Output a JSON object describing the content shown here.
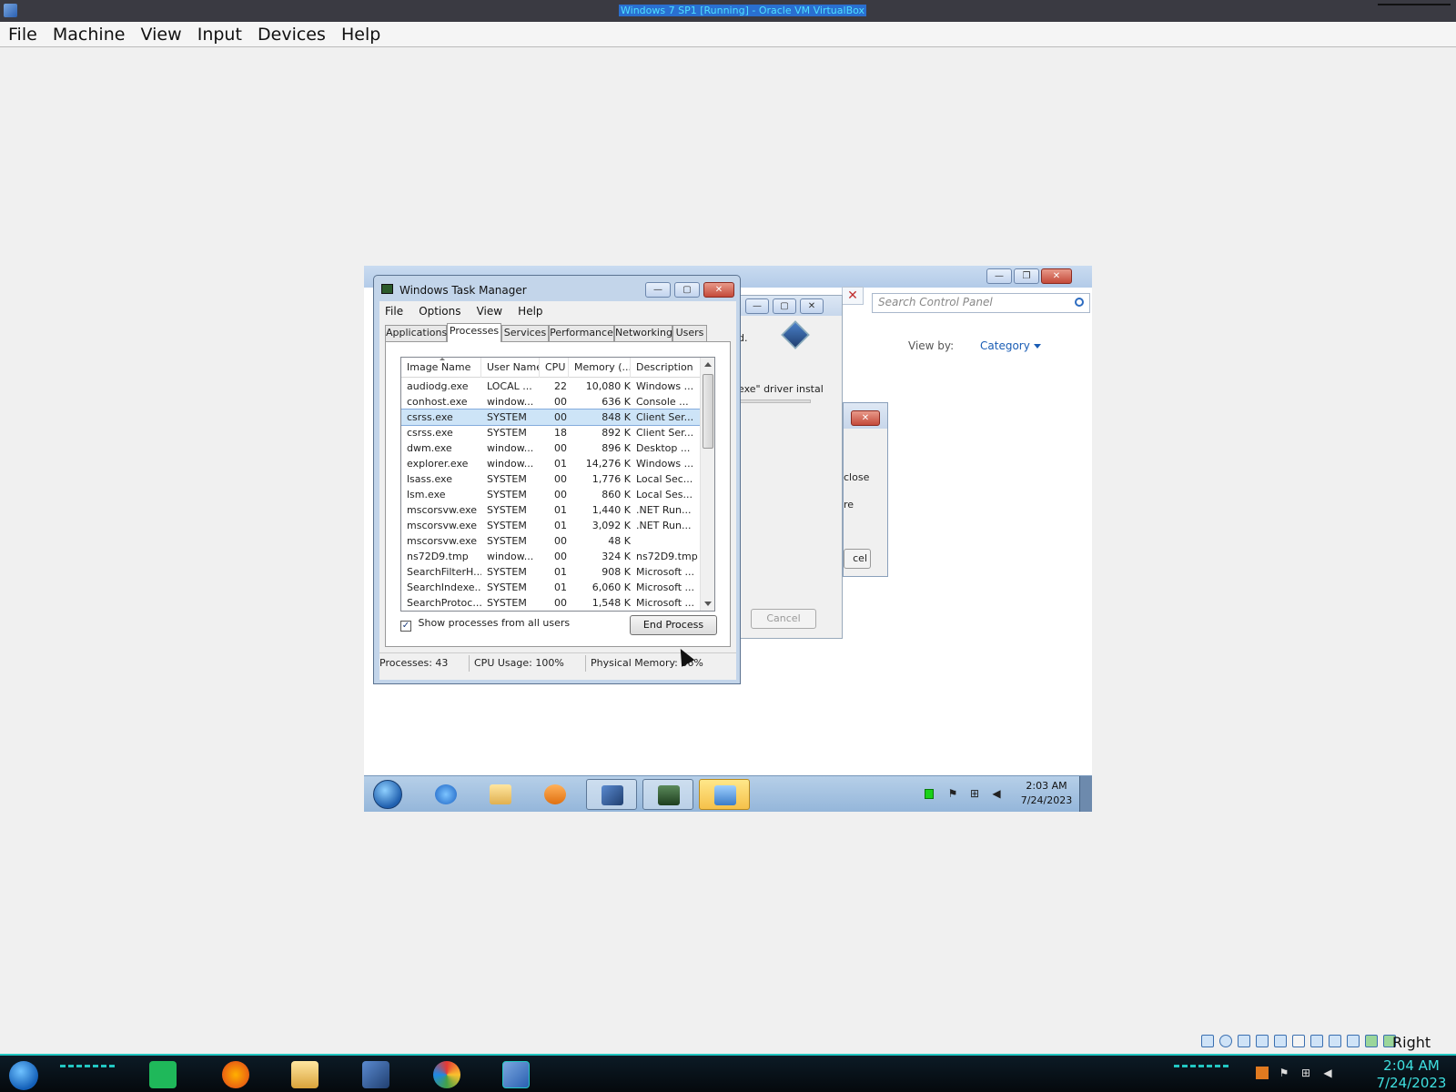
{
  "host": {
    "window_title": "Windows 7 SP1 [Running] - Oracle VM VirtualBox",
    "menu": [
      "File",
      "Machine",
      "View",
      "Input",
      "Devices",
      "Help"
    ],
    "host_key": "Right Ctrl",
    "clock_time": "2:04 AM",
    "clock_date": "7/24/2023"
  },
  "control_panel": {
    "search_placeholder": "Search Control Panel",
    "view_by_label": "View by:",
    "view_by_value": "Category"
  },
  "installer": {
    "text_a": "d.",
    "text_b": "exe\" driver instal",
    "cancel_label": "Cancel"
  },
  "confirm_dialog": {
    "text_a": "close",
    "text_b": "re",
    "button_label": "cel"
  },
  "task_manager": {
    "title": "Windows Task Manager",
    "menu": [
      "File",
      "Options",
      "View",
      "Help"
    ],
    "tabs": [
      "Applications",
      "Processes",
      "Services",
      "Performance",
      "Networking",
      "Users"
    ],
    "active_tab": "Processes",
    "columns": [
      "Image Name",
      "User Name",
      "CPU",
      "Memory (...",
      "Description"
    ],
    "rows": [
      {
        "name": "audiodg.exe",
        "user": "LOCAL ...",
        "cpu": "22",
        "mem": "10,080 K",
        "desc": "Windows ..."
      },
      {
        "name": "conhost.exe",
        "user": "window...",
        "cpu": "00",
        "mem": "636 K",
        "desc": "Console ..."
      },
      {
        "name": "csrss.exe",
        "user": "SYSTEM",
        "cpu": "00",
        "mem": "848 K",
        "desc": "Client Ser...",
        "selected": true
      },
      {
        "name": "csrss.exe",
        "user": "SYSTEM",
        "cpu": "18",
        "mem": "892 K",
        "desc": "Client Ser..."
      },
      {
        "name": "dwm.exe",
        "user": "window...",
        "cpu": "00",
        "mem": "896 K",
        "desc": "Desktop ..."
      },
      {
        "name": "explorer.exe",
        "user": "window...",
        "cpu": "01",
        "mem": "14,276 K",
        "desc": "Windows ..."
      },
      {
        "name": "lsass.exe",
        "user": "SYSTEM",
        "cpu": "00",
        "mem": "1,776 K",
        "desc": "Local Sec..."
      },
      {
        "name": "lsm.exe",
        "user": "SYSTEM",
        "cpu": "00",
        "mem": "860 K",
        "desc": "Local Ses..."
      },
      {
        "name": "mscorsvw.exe",
        "user": "SYSTEM",
        "cpu": "01",
        "mem": "1,440 K",
        "desc": ".NET Run..."
      },
      {
        "name": "mscorsvw.exe",
        "user": "SYSTEM",
        "cpu": "01",
        "mem": "3,092 K",
        "desc": ".NET Run..."
      },
      {
        "name": "mscorsvw.exe",
        "user": "SYSTEM",
        "cpu": "00",
        "mem": "48 K",
        "desc": ""
      },
      {
        "name": "ns72D9.tmp",
        "user": "window...",
        "cpu": "00",
        "mem": "324 K",
        "desc": "ns72D9.tmp"
      },
      {
        "name": "SearchFilterH...",
        "user": "SYSTEM",
        "cpu": "01",
        "mem": "908 K",
        "desc": "Microsoft ..."
      },
      {
        "name": "SearchIndexe...",
        "user": "SYSTEM",
        "cpu": "01",
        "mem": "6,060 K",
        "desc": "Microsoft ..."
      },
      {
        "name": "SearchProtoc...",
        "user": "SYSTEM",
        "cpu": "00",
        "mem": "1,548 K",
        "desc": "Microsoft ..."
      }
    ],
    "show_all_label": "Show processes from all users",
    "show_all_checked": true,
    "end_process_label": "End Process",
    "status": {
      "processes": "Processes: 43",
      "cpu": "CPU Usage: 100%",
      "memory": "Physical Memory: 36%"
    }
  },
  "guest_taskbar": {
    "clock_time": "2:03 AM",
    "clock_date": "7/24/2023"
  }
}
